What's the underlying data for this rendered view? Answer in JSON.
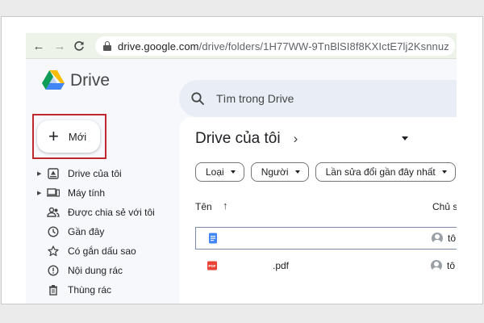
{
  "browser": {
    "url_host": "drive.google.com",
    "url_path": "/drive/folders/1H77WW-9TnBlSI8f8KXIctE7lj2Ksnnuz"
  },
  "app": {
    "title": "Drive"
  },
  "search": {
    "placeholder": "Tìm trong Drive"
  },
  "new_button": {
    "label": "Mới"
  },
  "sidebar": {
    "items": [
      {
        "label": "Drive của tôi",
        "icon": "my-drive-icon",
        "expandable": true
      },
      {
        "label": "Máy tính",
        "icon": "computer-icon",
        "expandable": true
      },
      {
        "label": "Được chia sẻ với tôi",
        "icon": "shared-icon",
        "expandable": false
      },
      {
        "label": "Gần đây",
        "icon": "clock-icon",
        "expandable": false
      },
      {
        "label": "Có gắn dấu sao",
        "icon": "star-icon",
        "expandable": false
      },
      {
        "label": "Nội dung rác",
        "icon": "spam-icon",
        "expandable": false
      },
      {
        "label": "Thùng rác",
        "icon": "trash-icon",
        "expandable": false
      }
    ]
  },
  "main": {
    "breadcrumb": "Drive của tôi",
    "filters": [
      {
        "label": "Loại"
      },
      {
        "label": "Người"
      },
      {
        "label": "Lần sửa đổi gần đây nhất"
      }
    ],
    "columns": {
      "name": "Tên",
      "owner": "Chủ sở"
    },
    "files": [
      {
        "name": "",
        "type": "doc",
        "owner": "tô",
        "selected": true
      },
      {
        "name": ".pdf",
        "type": "pdf",
        "owner": "tô",
        "selected": false
      }
    ]
  },
  "colors": {
    "accent_red": "#c0282d",
    "doc_blue": "#4285f4",
    "pdf_red": "#ea4335",
    "browser_bar": "#edf3e9"
  }
}
